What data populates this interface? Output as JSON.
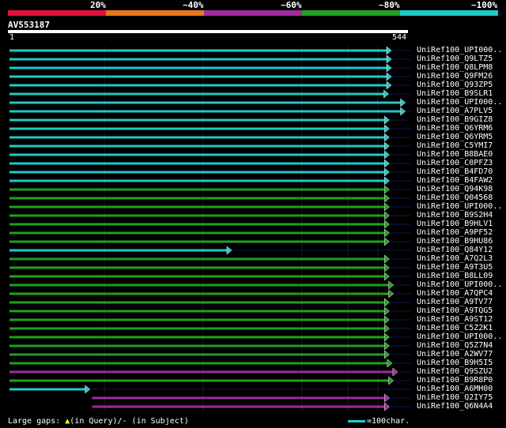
{
  "legend": {
    "labels": [
      "20%",
      "~40%",
      "~60%",
      "~80%",
      "~100%"
    ],
    "colors": [
      "#e0103a",
      "#e87820",
      "#a02aa0",
      "#20a020",
      "#20c8c8"
    ]
  },
  "query": {
    "name": "AV553187",
    "start": "1",
    "end": "544"
  },
  "hits": [
    {
      "name": "UniRef100_UPI000..",
      "start": 1,
      "end": 544,
      "color": "#20c8c8"
    },
    {
      "name": "UniRef100_Q9LTZ5",
      "start": 1,
      "end": 544,
      "color": "#20c8c8"
    },
    {
      "name": "UniRef100_Q8LPM8",
      "start": 1,
      "end": 544,
      "color": "#20c8c8"
    },
    {
      "name": "UniRef100_Q9FM26",
      "start": 1,
      "end": 544,
      "color": "#20c8c8"
    },
    {
      "name": "UniRef100_Q93ZP5",
      "start": 1,
      "end": 544,
      "color": "#20c8c8"
    },
    {
      "name": "UniRef100_B9SLR1",
      "start": 1,
      "end": 540,
      "color": "#20c8c8"
    },
    {
      "name": "UniRef100_UPI000..",
      "start": 1,
      "end": 564,
      "color": "#20c8c8"
    },
    {
      "name": "UniRef100_A7PLV5",
      "start": 1,
      "end": 564,
      "color": "#20c8c8"
    },
    {
      "name": "UniRef100_B9GIZ8",
      "start": 1,
      "end": 541,
      "color": "#20c8c8"
    },
    {
      "name": "UniRef100_Q6YRM6",
      "start": 1,
      "end": 541,
      "color": "#20c8c8"
    },
    {
      "name": "UniRef100_Q6YRM5",
      "start": 1,
      "end": 541,
      "color": "#20c8c8"
    },
    {
      "name": "UniRef100_C5YMI7",
      "start": 1,
      "end": 541,
      "color": "#20c8c8"
    },
    {
      "name": "UniRef100_B8BAE0",
      "start": 1,
      "end": 541,
      "color": "#20c8c8"
    },
    {
      "name": "UniRef100_C0PFZ3",
      "start": 1,
      "end": 541,
      "color": "#20c8c8"
    },
    {
      "name": "UniRef100_B4FD70",
      "start": 1,
      "end": 541,
      "color": "#20c8c8"
    },
    {
      "name": "UniRef100_B4FAW2",
      "start": 1,
      "end": 541,
      "color": "#20c8c8"
    },
    {
      "name": "UniRef100_Q94K98",
      "start": 1,
      "end": 541,
      "color": "#20a020"
    },
    {
      "name": "UniRef100_Q04568",
      "start": 1,
      "end": 541,
      "color": "#20a020"
    },
    {
      "name": "UniRef100_UPI000..",
      "start": 1,
      "end": 541,
      "color": "#20a020"
    },
    {
      "name": "UniRef100_B9S2H4",
      "start": 1,
      "end": 541,
      "color": "#20a020"
    },
    {
      "name": "UniRef100_B9HLV1",
      "start": 1,
      "end": 541,
      "color": "#20a020"
    },
    {
      "name": "UniRef100_A9PF52",
      "start": 1,
      "end": 541,
      "color": "#20a020"
    },
    {
      "name": "UniRef100_B9HU86",
      "start": 1,
      "end": 541,
      "color": "#20a020"
    },
    {
      "name": "UniRef100_Q84Y12",
      "start": 1,
      "end": 314,
      "color": "#20c8c8"
    },
    {
      "name": "UniRef100_A7Q2L3",
      "start": 1,
      "end": 541,
      "color": "#20a020"
    },
    {
      "name": "UniRef100_A9T3U5",
      "start": 1,
      "end": 541,
      "color": "#20a020"
    },
    {
      "name": "UniRef100_B8LL09",
      "start": 1,
      "end": 541,
      "color": "#20a020"
    },
    {
      "name": "UniRef100_UPI000..",
      "start": 1,
      "end": 547,
      "color": "#20a020"
    },
    {
      "name": "UniRef100_A7QPC4",
      "start": 1,
      "end": 547,
      "color": "#20a020"
    },
    {
      "name": "UniRef100_A9TV77",
      "start": 1,
      "end": 541,
      "color": "#20a020"
    },
    {
      "name": "UniRef100_A9TQG5",
      "start": 1,
      "end": 541,
      "color": "#20a020"
    },
    {
      "name": "UniRef100_A9ST12",
      "start": 1,
      "end": 541,
      "color": "#20a020"
    },
    {
      "name": "UniRef100_C5Z2K1",
      "start": 1,
      "end": 541,
      "color": "#20a020"
    },
    {
      "name": "UniRef100_UPI000..",
      "start": 1,
      "end": 541,
      "color": "#20a020"
    },
    {
      "name": "UniRef100_Q5Z7N4",
      "start": 1,
      "end": 541,
      "color": "#20a020"
    },
    {
      "name": "UniRef100_A2WV77",
      "start": 1,
      "end": 541,
      "color": "#20a020"
    },
    {
      "name": "UniRef100_B9H5I5",
      "start": 1,
      "end": 545,
      "color": "#20a020"
    },
    {
      "name": "UniRef100_Q9SZU2",
      "start": 1,
      "end": 553,
      "color": "#a02aa0"
    },
    {
      "name": "UniRef100_B9R8P0",
      "start": 1,
      "end": 547,
      "color": "#20a020"
    },
    {
      "name": "UniRef100_A6MH00",
      "start": 1,
      "end": 110,
      "color": "#20c8c8"
    },
    {
      "name": "UniRef100_Q2IY75",
      "start": 120,
      "end": 541,
      "color": "#a02aa0"
    },
    {
      "name": "UniRef100_Q6N4A4",
      "start": 120,
      "end": 541,
      "color": "#a02aa0"
    }
  ],
  "footer": {
    "gaps_label": "Large gaps: ",
    "in_query": "(in Query)/",
    "in_subject": "- (in Subject)",
    "scale_label": "=100char."
  }
}
